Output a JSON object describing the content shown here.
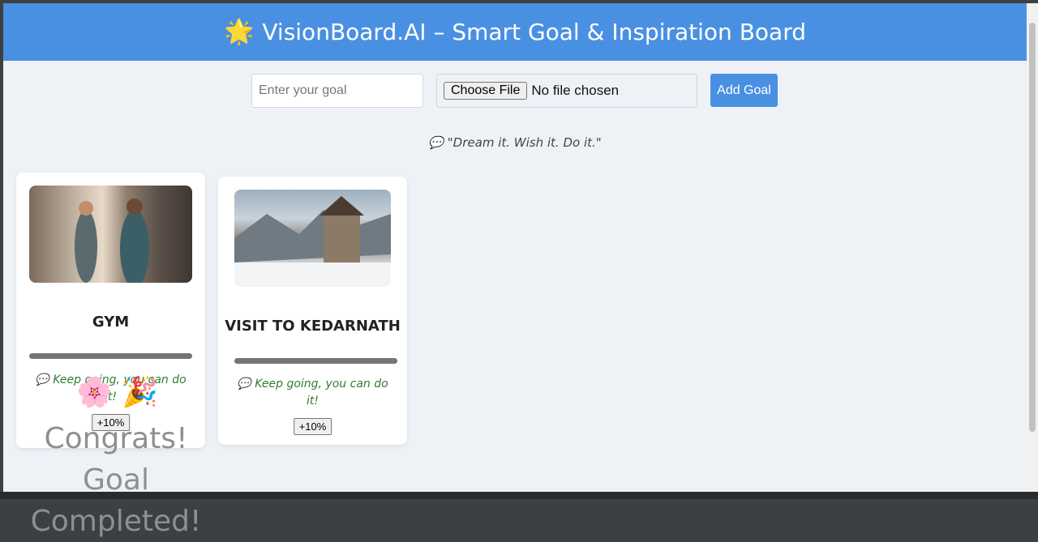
{
  "header": {
    "icon": "star-icon",
    "title": "VisionBoard.AI – Smart Goal & Inspiration Board"
  },
  "form": {
    "goal_placeholder": "Enter your goal",
    "file_button_label": "Choose File",
    "file_status": "No file chosen",
    "add_button_label": "Add Goal"
  },
  "quote": {
    "icon": "speech-bubble-icon",
    "text": "\"Dream it. Wish it. Do it.\""
  },
  "goals": [
    {
      "title": "GYM",
      "progress": 1.0,
      "message": "Keep going, you can do it!",
      "increment_label": "+10%"
    },
    {
      "title": "VISIT TO KEDARNATH",
      "progress": 1.0,
      "message": "Keep going, you can do it!",
      "increment_label": "+10%"
    }
  ],
  "celebration": {
    "emojis": [
      "🌸",
      "🎉"
    ],
    "text": "Congrats! Goal Completed!"
  },
  "colors": {
    "header_bg": "#4a90e2",
    "accent": "#4a90e2",
    "motivation_text": "#2e7d32"
  }
}
